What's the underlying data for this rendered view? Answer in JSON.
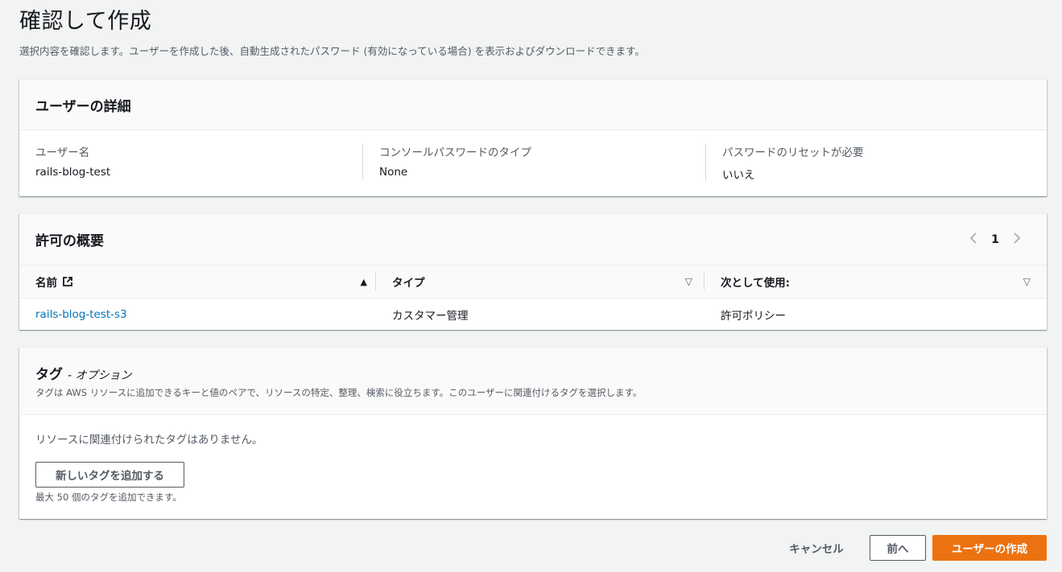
{
  "page": {
    "title": "確認して作成",
    "description": "選択内容を確認します。ユーザーを作成した後、自動生成されたパスワード (有効になっている場合) を表示およびダウンロードできます。"
  },
  "details": {
    "title": "ユーザーの詳細",
    "fields": [
      {
        "label": "ユーザー名",
        "value": "rails-blog-test"
      },
      {
        "label": "コンソールパスワードのタイプ",
        "value": "None"
      },
      {
        "label": "パスワードのリセットが必要",
        "value": "いいえ"
      }
    ]
  },
  "permissions": {
    "title": "許可の概要",
    "page_number": "1",
    "prev_icon": "chevron-left-icon",
    "next_icon": "chevron-right-icon",
    "columns": [
      "名前",
      "タイプ",
      "次として使用:"
    ],
    "rows": [
      {
        "name": "rails-blog-test-s3",
        "type": "カスタマー管理",
        "used_as": "許可ポリシー"
      }
    ]
  },
  "tags": {
    "title": "タグ",
    "title_suffix": "- オプション",
    "description": "タグは AWS リソースに追加できるキーと値のペアで、リソースの特定、整理、検索に役立ちます。このユーザーに関連付けるタグを選択します。",
    "empty_text": "リソースに関連付けられたタグはありません。",
    "add_button": "新しいタグを追加する",
    "limit_text": "最大 50 個のタグを追加できます。"
  },
  "footer": {
    "cancel": "キャンセル",
    "previous": "前へ",
    "create": "ユーザーの作成"
  },
  "colors": {
    "primary_button": "#ec7211",
    "link": "#0073bb",
    "background": "#f2f3f3"
  }
}
